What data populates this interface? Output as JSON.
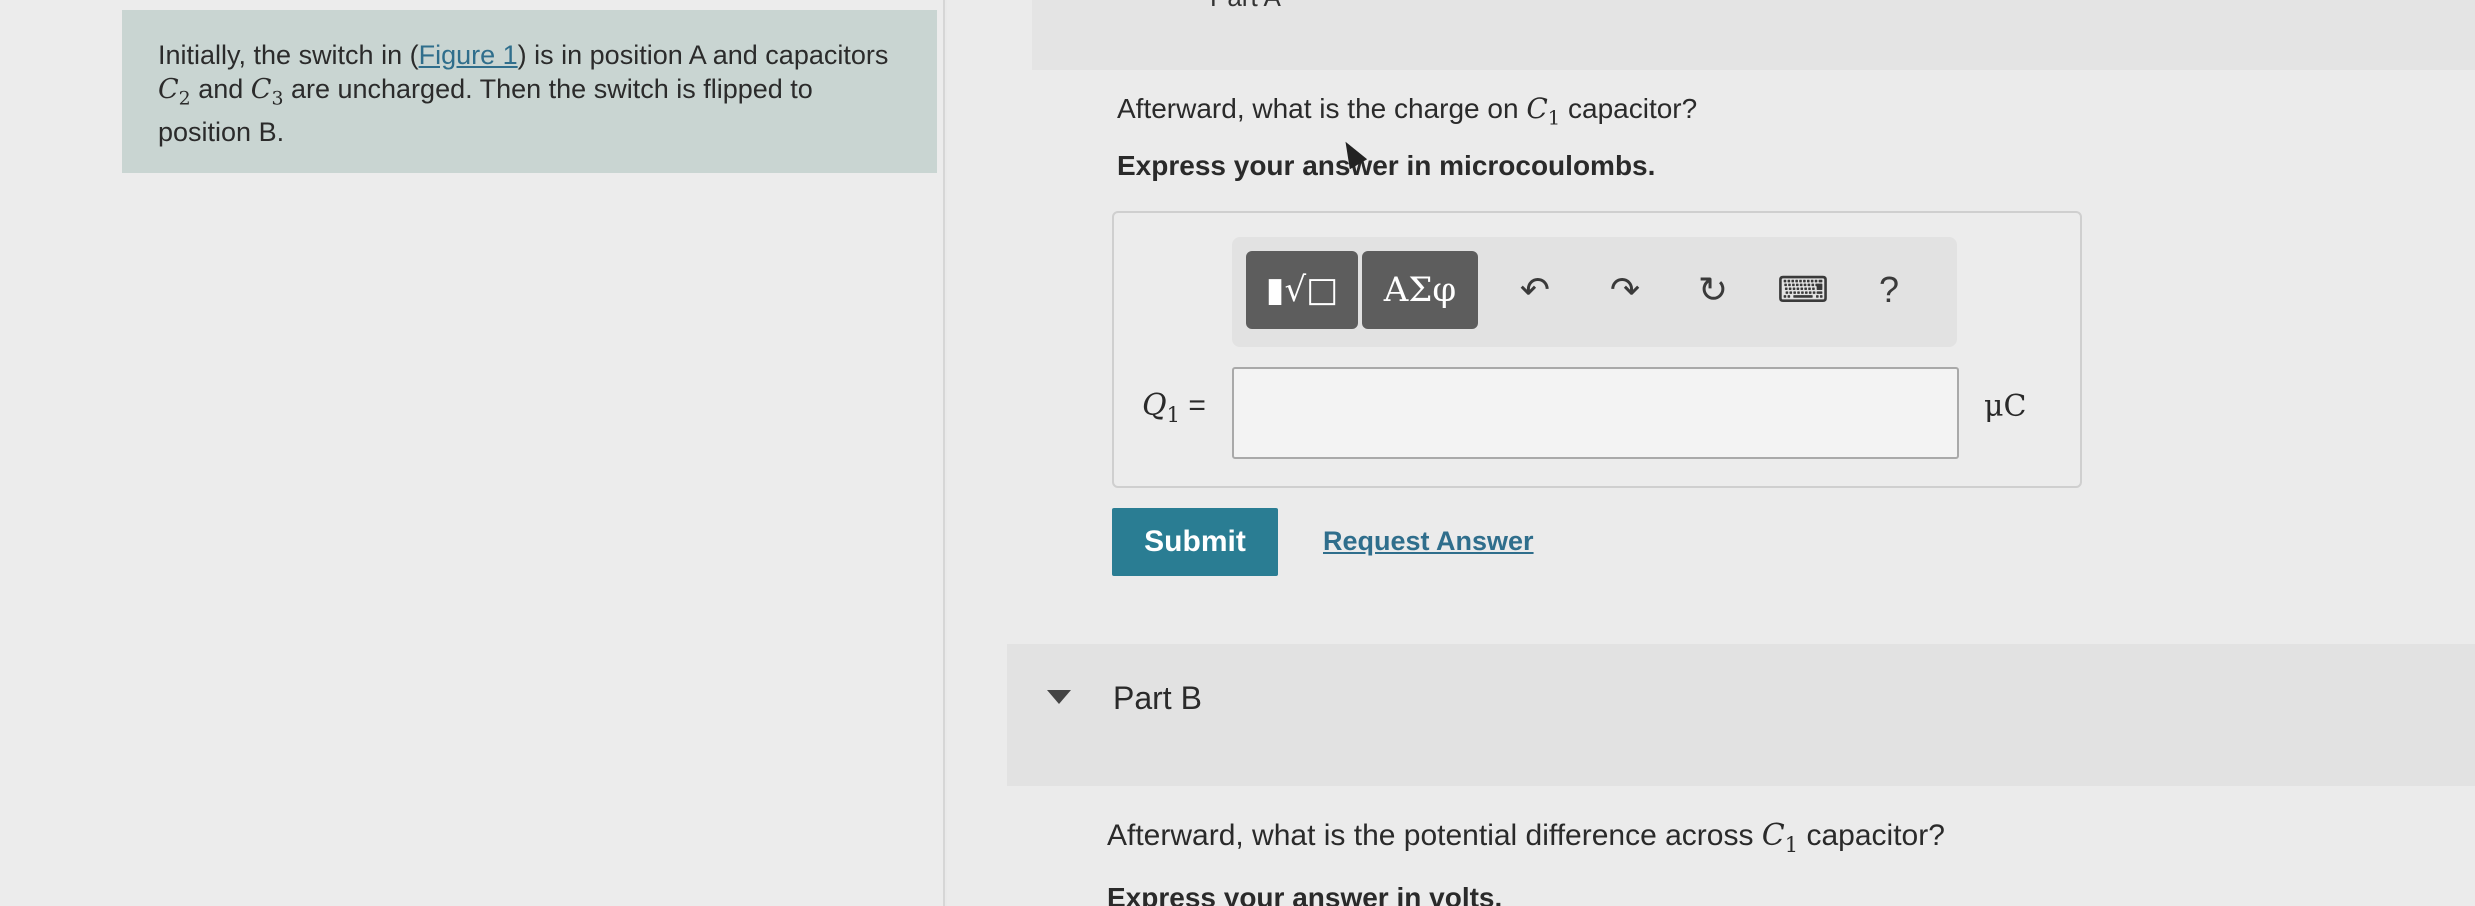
{
  "intro": {
    "text_1": "Initially, the switch in (",
    "figure_link": "Figure 1",
    "text_2": ") is in position A and capacitors ",
    "c2": "C",
    "c2_sub": "2",
    "text_3": " and ",
    "c3": "C",
    "c3_sub": "3",
    "text_4": " are uncharged. Then the switch is flipped to position B."
  },
  "part_a": {
    "title_cut": "Part A",
    "question_1": "Afterward, what is the charge on ",
    "c1": "C",
    "c1_sub": "1",
    "question_2": " capacitor?",
    "instruction": "Express your answer in microcoulombs.",
    "toolbar": {
      "templates_glyph": "▮√□",
      "symbols_label": "ΑΣφ",
      "undo_glyph": "↶",
      "redo_glyph": "↷",
      "reset_glyph": "↻",
      "keyboard_glyph": "⌨",
      "help_glyph": "?"
    },
    "eq_var": "Q",
    "eq_sub": "1",
    "eq_sign": " =",
    "input_value": "",
    "unit": "μC",
    "submit_label": "Submit",
    "request_label": "Request Answer"
  },
  "part_b": {
    "title": "Part B",
    "question_1": "Afterward, what is the potential difference across ",
    "c1": "C",
    "c1_sub": "1",
    "question_2": " capacitor?",
    "instruction_cut": "Express your answer in volts."
  },
  "colors": {
    "intro_bg": "#c9d5d2",
    "submit_bg": "#2a7d93",
    "link": "#2f6e8c",
    "toolbar_button": "#5d5d5d"
  }
}
